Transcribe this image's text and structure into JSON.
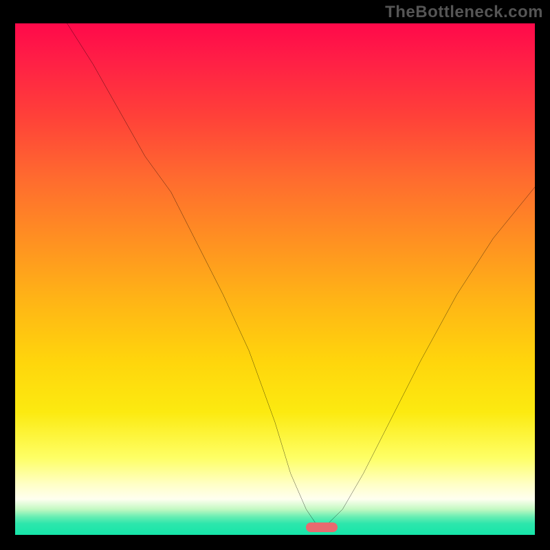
{
  "watermark": "TheBottleneck.com",
  "colors": {
    "frame": "#000000",
    "watermark": "#555555",
    "curve": "#000000",
    "marker": "#e86a6f",
    "gradient_stops": [
      "#ff094a",
      "#ff1e46",
      "#ff4039",
      "#ff6a2f",
      "#ff8f22",
      "#ffb416",
      "#ffd50c",
      "#fcea10",
      "#feff66",
      "#ffffc4",
      "#fffff0",
      "#c2f9c2",
      "#66eeb3",
      "#2de6ac",
      "#16e5a9"
    ]
  },
  "chart_data": {
    "type": "line",
    "title": "",
    "xlabel": "",
    "ylabel": "",
    "xlim": [
      0,
      100
    ],
    "ylim": [
      0,
      100
    ],
    "series": [
      {
        "name": "bottleneck-curve",
        "x": [
          10,
          15,
          20,
          25,
          30,
          35,
          40,
          45,
          50,
          53,
          56,
          58,
          60,
          63,
          67,
          72,
          78,
          85,
          92,
          100
        ],
        "y": [
          100,
          92,
          83,
          74,
          67,
          57,
          47,
          36,
          22,
          12,
          5,
          2,
          2,
          5,
          12,
          22,
          34,
          47,
          58,
          68
        ]
      }
    ],
    "annotations": [
      {
        "name": "current-config-marker",
        "x_center": 59,
        "width": 6,
        "y": 0.5
      }
    ],
    "background": {
      "type": "vertical-gradient",
      "meaning": "bottleneck-severity",
      "top_value": 100,
      "bottom_value": 0
    }
  }
}
